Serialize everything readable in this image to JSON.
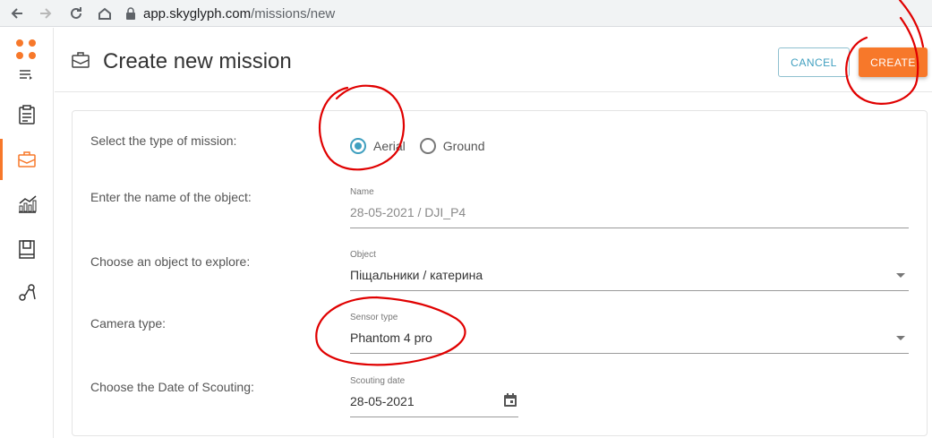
{
  "browser": {
    "url_host": "app.skyglyph.com",
    "url_path": "/missions/new"
  },
  "icons": {
    "back": "arrow-left-icon",
    "forward": "arrow-right-icon",
    "reload": "reload-icon",
    "home": "home-icon",
    "lock": "lock-icon",
    "menu": "menu-toggle-icon",
    "clipboard": "clipboard-icon",
    "briefcase": "briefcase-icon",
    "chart": "chart-icon",
    "book": "book-icon",
    "route": "route-icon",
    "calendar": "calendar-icon"
  },
  "colors": {
    "accent_orange": "#f7782a",
    "accent_blue": "#3f9fbf",
    "annotation_red": "#e00000"
  },
  "header": {
    "title": "Create new mission",
    "cancel_label": "CANCEL",
    "create_label": "CREATE"
  },
  "form": {
    "mission_type": {
      "label": "Select the type of mission:",
      "options": [
        {
          "label": "Aerial",
          "checked": true
        },
        {
          "label": "Ground",
          "checked": false
        }
      ]
    },
    "name": {
      "label": "Enter the name of the object:",
      "field_label": "Name",
      "value": "28-05-2021 / DJI_P4"
    },
    "object": {
      "label": "Choose an object to explore:",
      "field_label": "Object",
      "value": "Піщальники / катерина"
    },
    "camera": {
      "label": "Camera type:",
      "field_label": "Sensor type",
      "value": "Phantom 4 pro"
    },
    "date": {
      "label": "Choose the Date of Scouting:",
      "field_label": "Scouting date",
      "value": "28-05-2021"
    }
  }
}
